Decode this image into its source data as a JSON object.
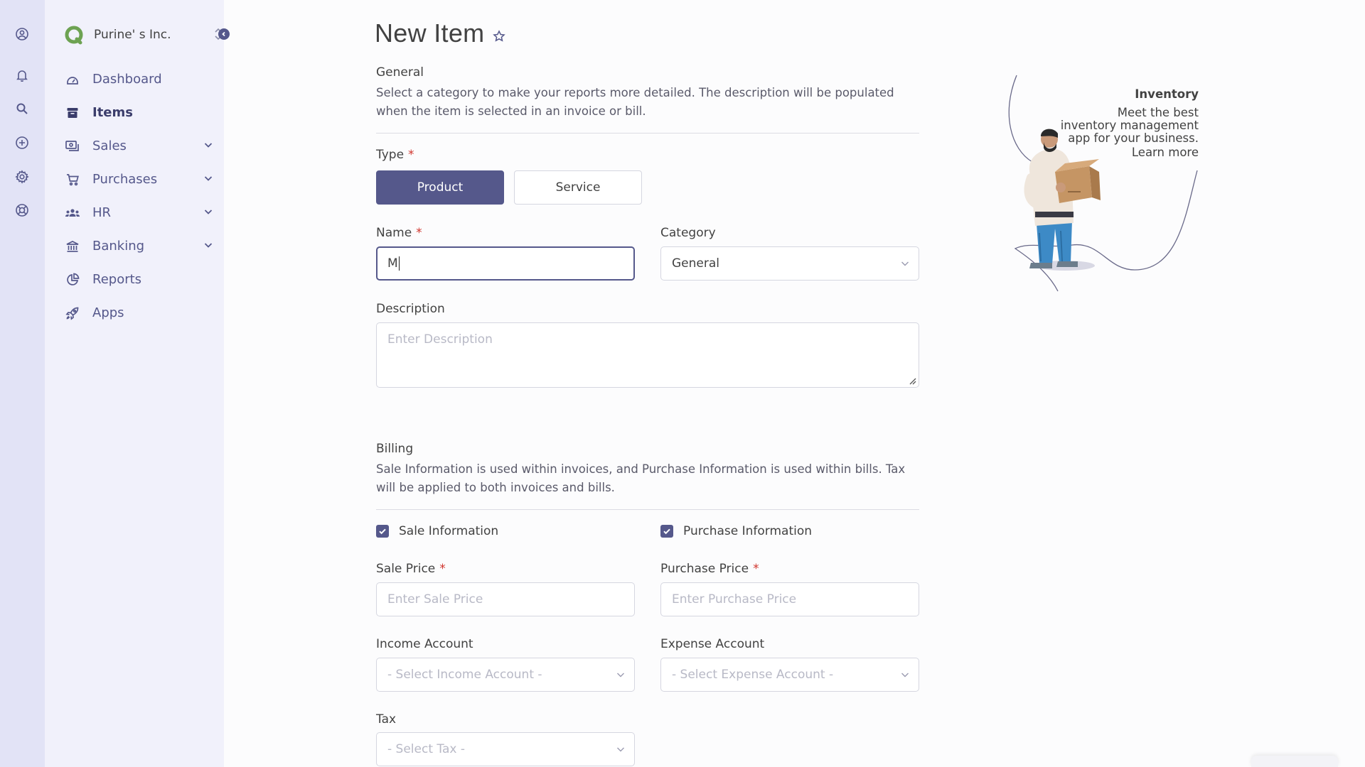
{
  "rail": {
    "icons": [
      "profile-icon",
      "bell-icon",
      "search-icon",
      "plus-circle-icon",
      "settings-icon",
      "support-icon"
    ]
  },
  "sidebar": {
    "company_name": "Purine' s Inc.",
    "items": [
      {
        "label": "Dashboard",
        "icon": "dashboard-icon",
        "has_submenu": false,
        "active": false
      },
      {
        "label": "Items",
        "icon": "items-icon",
        "has_submenu": false,
        "active": true
      },
      {
        "label": "Sales",
        "icon": "sales-icon",
        "has_submenu": true,
        "active": false
      },
      {
        "label": "Purchases",
        "icon": "cart-icon",
        "has_submenu": true,
        "active": false
      },
      {
        "label": "HR",
        "icon": "people-icon",
        "has_submenu": true,
        "active": false
      },
      {
        "label": "Banking",
        "icon": "bank-icon",
        "has_submenu": true,
        "active": false
      },
      {
        "label": "Reports",
        "icon": "reports-icon",
        "has_submenu": false,
        "active": false
      },
      {
        "label": "Apps",
        "icon": "rocket-icon",
        "has_submenu": false,
        "active": false
      }
    ]
  },
  "page": {
    "title": "New Item"
  },
  "general": {
    "title": "General",
    "description": "Select a category to make your reports more detailed. The description will be populated when the item is selected in an invoice or bill.",
    "type_label": "Type",
    "required_mark": "*",
    "type_product": "Product",
    "type_service": "Service",
    "selected_type": "Product",
    "name_label": "Name",
    "name_value": "M",
    "category_label": "Category",
    "category_value": "General",
    "description_label": "Description",
    "description_placeholder": "Enter Description"
  },
  "billing": {
    "title": "Billing",
    "description": "Sale Information is used within invoices, and Purchase Information is used within bills. Tax will be applied to both invoices and bills.",
    "sale_info_label": "Sale Information",
    "sale_info_checked": true,
    "purchase_info_label": "Purchase Information",
    "purchase_info_checked": true,
    "sale_price_label": "Sale Price",
    "sale_price_placeholder": "Enter Sale Price",
    "purchase_price_label": "Purchase Price",
    "purchase_price_placeholder": "Enter Purchase Price",
    "income_account_label": "Income Account",
    "income_account_placeholder": "- Select Income Account -",
    "expense_account_label": "Expense Account",
    "expense_account_placeholder": "- Select Expense Account -",
    "tax_label": "Tax",
    "tax_placeholder": "- Select Tax -"
  },
  "promo": {
    "title": "Inventory",
    "line1": "Meet the best",
    "line2": "inventory management",
    "line3": "app for your business.",
    "link": "Learn more"
  },
  "colors": {
    "accent": "#55588b",
    "rail_bg": "#e2e3f6",
    "sidebar_bg": "#f1f1fb",
    "required": "#d0342c"
  }
}
